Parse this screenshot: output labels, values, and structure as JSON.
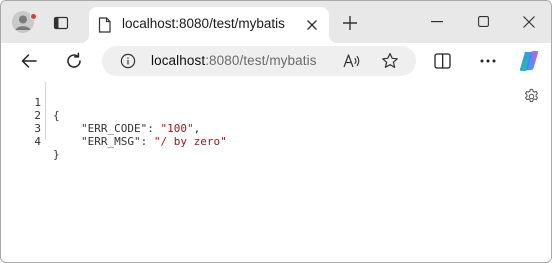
{
  "tab": {
    "title": "localhost:8080/test/mybatis",
    "close_label": "close-tab"
  },
  "address": {
    "host": "localhost",
    "path": ":8080/test/mybatis"
  },
  "json_view": {
    "lines": [
      {
        "num": "1",
        "open": "{"
      },
      {
        "num": "2",
        "key": "\"ERR_CODE\"",
        "sep": ": ",
        "value": "\"100\"",
        "tail": ","
      },
      {
        "num": "3",
        "key": "\"ERR_MSG\"",
        "sep": ": ",
        "value": "\"/ by zero\"",
        "tail": ""
      },
      {
        "num": "4",
        "close": "}"
      }
    ]
  },
  "colors": {
    "tabstrip": "#e8e8e8",
    "string": "#a31515",
    "notification_dot": "#e23b2e"
  },
  "icons": [
    "profile-icon",
    "tab-actions-icon",
    "page-icon",
    "close-icon",
    "new-tab-icon",
    "minimize-icon",
    "maximize-icon",
    "window-close-icon",
    "back-icon",
    "refresh-icon",
    "info-icon",
    "read-aloud-icon",
    "favorite-icon",
    "split-screen-icon",
    "more-icon",
    "copilot-icon",
    "settings-icon"
  ]
}
